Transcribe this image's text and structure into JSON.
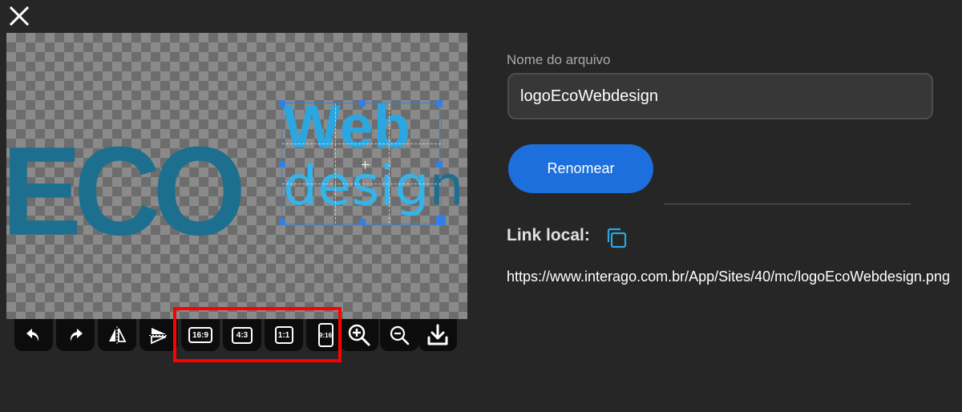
{
  "window": {
    "close_icon": "close-icon"
  },
  "preview": {
    "logo_line1": "ECO",
    "logo_line2": "Web",
    "logo_line3": "desig",
    "logo_line3_tail": "n"
  },
  "toolbar": {
    "tools": [
      {
        "name": "undo-icon"
      },
      {
        "name": "redo-icon"
      },
      {
        "name": "flip-horizontal-icon"
      },
      {
        "name": "flip-vertical-icon"
      },
      {
        "label": "16:9"
      },
      {
        "label": "4:3"
      },
      {
        "label": "1:1"
      },
      {
        "label": "9:16"
      },
      {
        "name": "zoom-in-icon"
      },
      {
        "name": "zoom-out-icon"
      },
      {
        "name": "download-icon"
      }
    ]
  },
  "form": {
    "file_name_label": "Nome do arquivo",
    "file_name_value": "logoEcoWebdesign",
    "rename_button": "Renomear",
    "link_label": "Link local:",
    "link_url": "https://www.interago.com.br/App/Sites/40/mc/logoEcoWebdesign.png"
  },
  "colors": {
    "accent": "#1c6fdc",
    "selection": "#2f80ed",
    "highlight": "#ff0000",
    "logo_dark": "#1d6f8f",
    "logo_light": "#2aa7e0"
  }
}
